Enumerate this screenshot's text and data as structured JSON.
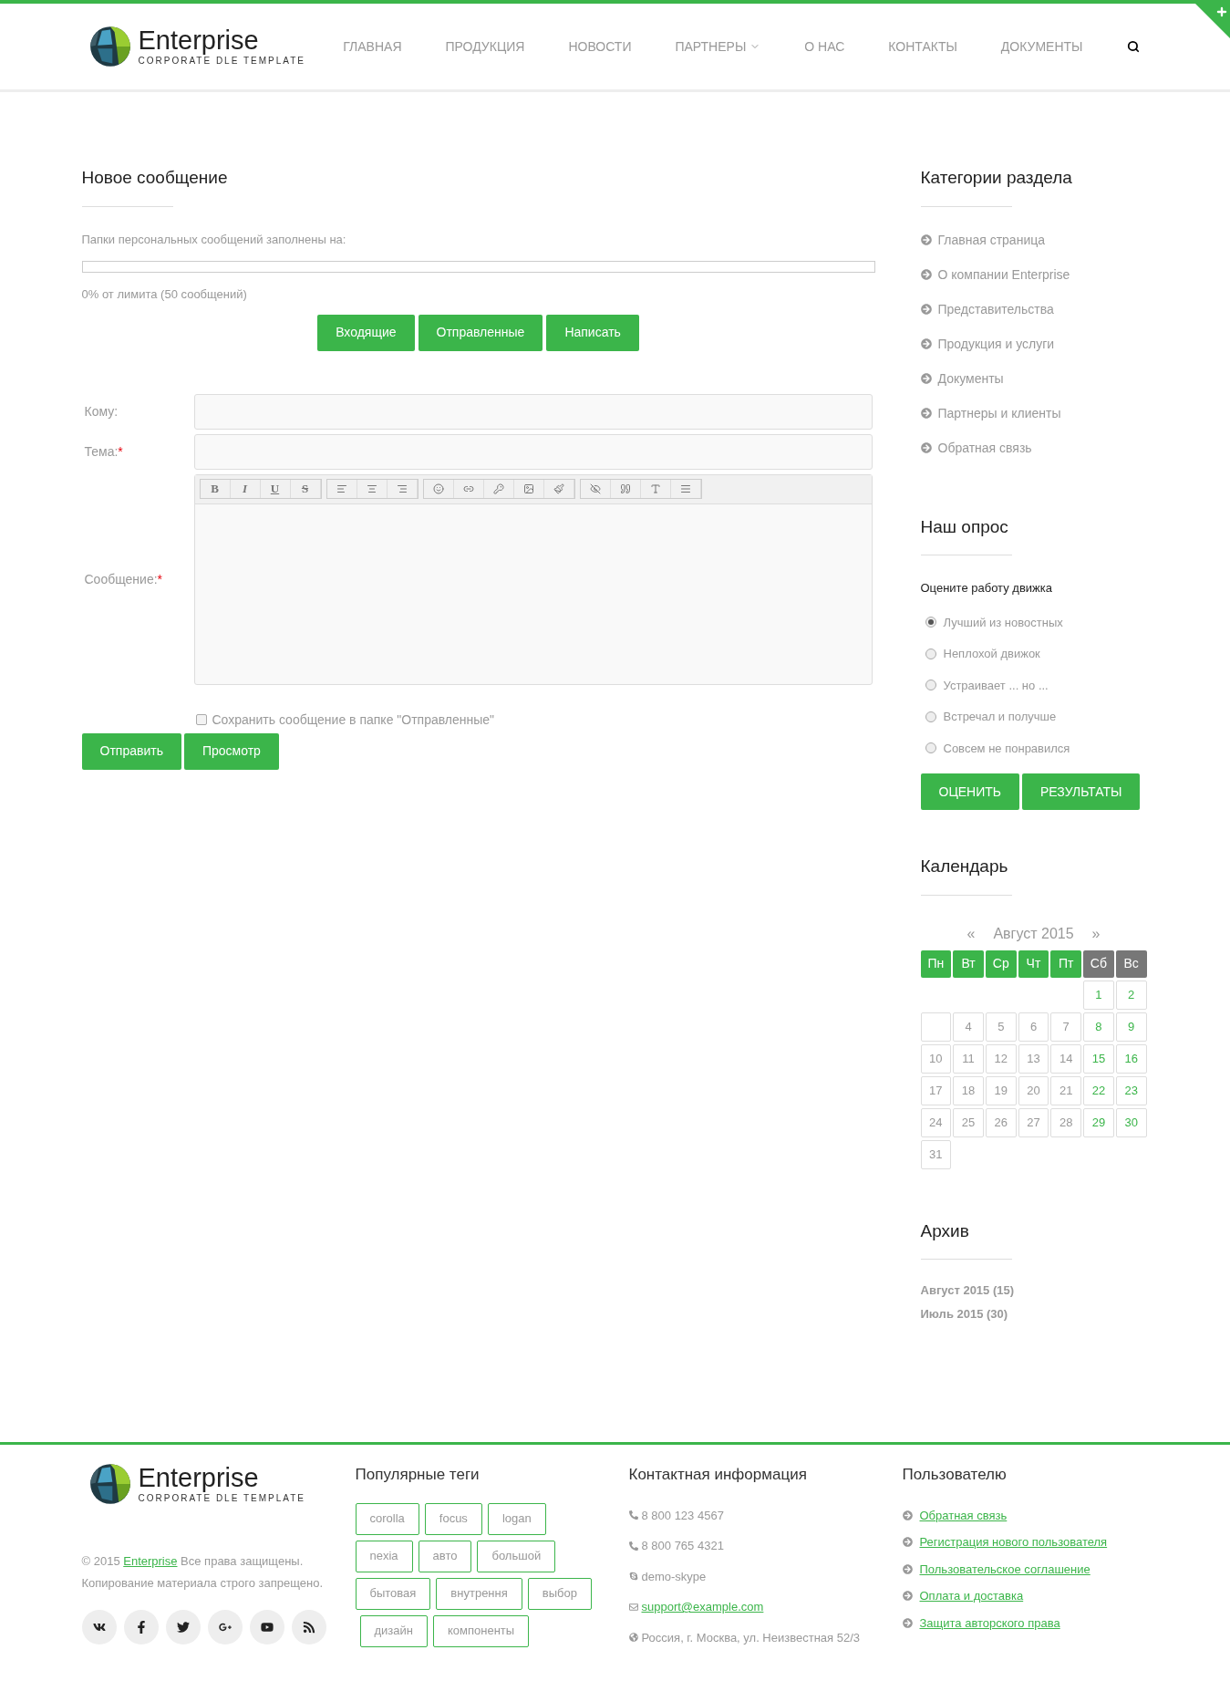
{
  "header": {
    "logo": {
      "name": "Enterprise",
      "tagline": "CORPORATE DLE TEMPLATE"
    },
    "nav": [
      {
        "label": "ГЛАВНАЯ",
        "dropdown": false
      },
      {
        "label": "ПРОДУКЦИЯ",
        "dropdown": false
      },
      {
        "label": "НОВОСТИ",
        "dropdown": false
      },
      {
        "label": "ПАРТНЕРЫ",
        "dropdown": true
      },
      {
        "label": "О НАС",
        "dropdown": false
      },
      {
        "label": "КОНТАКТЫ",
        "dropdown": false
      },
      {
        "label": "ДОКУМЕНТЫ",
        "dropdown": false
      }
    ]
  },
  "main": {
    "title": "Новое сообщение",
    "quota_label": "Папки персональных сообщений заполнены на:",
    "quota": {
      "level": 0
    },
    "quota_text": "0% от лимита (50 сообщений)",
    "folder_buttons": [
      "Входящие",
      "Отправленные",
      "Написать"
    ],
    "fields": [
      {
        "label": "Кому:"
      },
      {
        "label": "Тема:",
        "required_mark": "*"
      }
    ],
    "message_label": "Сообщение:",
    "message_required_mark": "*",
    "format_buttons": [
      "B",
      "I",
      "U",
      "S"
    ],
    "save_copy": {
      "label": "Сохранить сообщение в папке \"Отправленные\"",
      "checked": false
    },
    "actions": [
      "Отправить",
      "Просмотр"
    ]
  },
  "sidebar": {
    "categories": {
      "title": "Категории раздела",
      "items": [
        "Главная страница",
        "О компании Enterprise",
        "Представительства",
        "Продукция и услуги",
        "Документы",
        "Партнеры и клиенты",
        "Обратная связь"
      ]
    },
    "poll": {
      "title": "Наш опрос",
      "question": "Оцените работу движка",
      "options": [
        {
          "label": "Лучший из новостных",
          "selected": true
        },
        {
          "label": "Неплохой движок",
          "selected": false
        },
        {
          "label": "Устраивает ... но ...",
          "selected": false
        },
        {
          "label": "Встречал и получше",
          "selected": false
        },
        {
          "label": "Совсем не понравился",
          "selected": false
        }
      ],
      "buttons": [
        "ОЦЕНИТЬ",
        "РЕЗУЛЬТАТЫ"
      ]
    },
    "calendar": {
      "title": "Календарь",
      "prev": "«",
      "month": "Август 2015",
      "next": "»",
      "weekdays": [
        {
          "label": "Пн",
          "weekend": false
        },
        {
          "label": "Вт",
          "weekend": false
        },
        {
          "label": "Ср",
          "weekend": false
        },
        {
          "label": "Чт",
          "weekend": false
        },
        {
          "label": "Пт",
          "weekend": false
        },
        {
          "label": "Сб",
          "weekend": true
        },
        {
          "label": "Вс",
          "weekend": true
        }
      ],
      "weeks": [
        [
          {
            "kind": "blank"
          },
          {
            "kind": "blank"
          },
          {
            "kind": "blank"
          },
          {
            "kind": "blank"
          },
          {
            "kind": "blank"
          },
          {
            "kind": "day",
            "day": "1"
          },
          {
            "kind": "day",
            "day": "2"
          }
        ],
        [
          {
            "kind": "empty"
          },
          {
            "kind": "day",
            "day": "4"
          },
          {
            "kind": "day",
            "day": "5"
          },
          {
            "kind": "day",
            "day": "6"
          },
          {
            "kind": "day",
            "day": "7"
          },
          {
            "kind": "day",
            "day": "8"
          },
          {
            "kind": "day",
            "day": "9"
          }
        ],
        [
          {
            "kind": "day",
            "day": "10"
          },
          {
            "kind": "day",
            "day": "11"
          },
          {
            "kind": "day",
            "day": "12"
          },
          {
            "kind": "day",
            "day": "13"
          },
          {
            "kind": "day",
            "day": "14"
          },
          {
            "kind": "day",
            "day": "15"
          },
          {
            "kind": "day",
            "day": "16"
          }
        ],
        [
          {
            "kind": "day",
            "day": "17"
          },
          {
            "kind": "day",
            "day": "18"
          },
          {
            "kind": "day",
            "day": "19"
          },
          {
            "kind": "day",
            "day": "20"
          },
          {
            "kind": "day",
            "day": "21"
          },
          {
            "kind": "day",
            "day": "22"
          },
          {
            "kind": "day",
            "day": "23"
          }
        ],
        [
          {
            "kind": "day",
            "day": "24"
          },
          {
            "kind": "day",
            "day": "25"
          },
          {
            "kind": "day",
            "day": "26"
          },
          {
            "kind": "day",
            "day": "27"
          },
          {
            "kind": "day",
            "day": "28"
          },
          {
            "kind": "day",
            "day": "29"
          },
          {
            "kind": "day",
            "day": "30"
          }
        ],
        [
          {
            "kind": "day",
            "day": "31"
          }
        ]
      ]
    },
    "archive": {
      "title": "Архив",
      "items": [
        "Август 2015 (15)",
        "Июль 2015 (30)"
      ]
    }
  },
  "footer": {
    "logo": {
      "name": "Enterprise",
      "tagline": "CORPORATE DLE TEMPLATE"
    },
    "copyright": {
      "prefix": "© 2015 ",
      "link": "Enterprise",
      "suffix": " Все права защищены."
    },
    "notice": "Копирование материала строго запрещено.",
    "social": [
      {
        "kind": "vk"
      },
      {
        "kind": "facebook"
      },
      {
        "kind": "twitter"
      },
      {
        "kind": "googleplus"
      },
      {
        "kind": "youtube"
      },
      {
        "kind": "rss"
      }
    ],
    "tags": {
      "title": "Популярные теги",
      "rows": [
        [
          "corolla",
          "focus",
          "logan"
        ],
        [
          "nexia",
          "авто",
          "большой"
        ],
        [
          "бытовая",
          "внутрення",
          "выбор"
        ],
        [
          "дизайн",
          "компоненты"
        ]
      ]
    },
    "contacts": {
      "title": "Контактная информация",
      "items": [
        {
          "kind": "phone",
          "text": "8 800 123 4567"
        },
        {
          "kind": "phone",
          "text": "8 800 765 4321"
        },
        {
          "kind": "skype",
          "text": "demo-skype"
        },
        {
          "kind": "email",
          "text": "support@example.com"
        },
        {
          "kind": "address",
          "text": "Россия, г. Москва, ул. Неизвестная 52/3"
        }
      ]
    },
    "users": {
      "title": "Пользователю",
      "links": [
        "Обратная связь",
        "Регистрация нового пользователя",
        "Пользовательское соглашение",
        "Оплата и доставка",
        "Защита авторского права"
      ]
    }
  }
}
